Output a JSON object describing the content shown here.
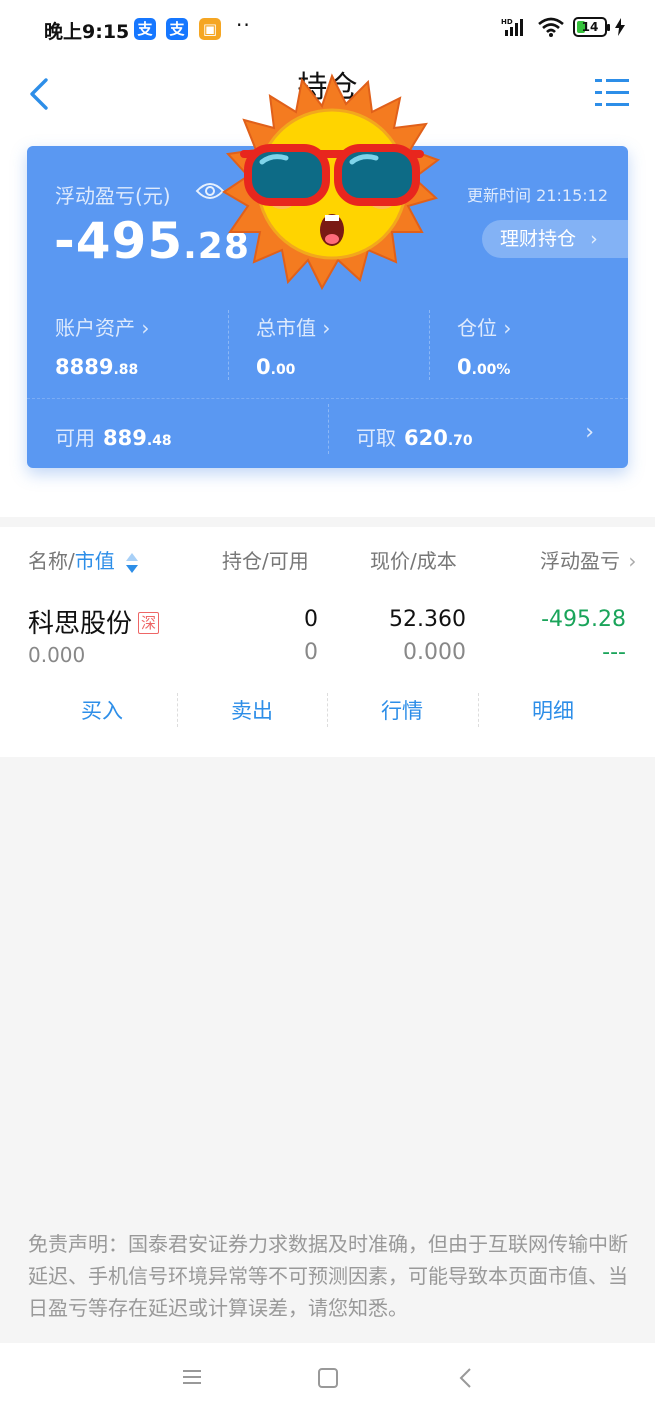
{
  "status_bar": {
    "time": "晚上9:15",
    "apps": [
      "支",
      "支",
      "▣"
    ],
    "dots": "··",
    "battery": "14"
  },
  "header": {
    "title": "持仓"
  },
  "summary": {
    "pl_label": "浮动盈亏(元)",
    "pl_int": "-495",
    "pl_dec": ".28",
    "update_label": "更新时间 21:15:12",
    "wealth_button": "理财持仓",
    "assets_label": "账户资产",
    "assets_int": "8889",
    "assets_dec": ".88",
    "market_label": "总市值",
    "market_int": "0",
    "market_dec": ".00",
    "position_label": "仓位",
    "position_int": "0",
    "position_dec": ".00%",
    "available_label": "可用",
    "available_int": "889",
    "available_dec": ".48",
    "withdraw_label": "可取",
    "withdraw_int": "620",
    "withdraw_dec": ".70"
  },
  "table": {
    "col_name": "名称/",
    "col_name_sort": "市值",
    "col_qty": "持仓/可用",
    "col_price": "现价/成本",
    "col_pl": "浮动盈亏",
    "rows": [
      {
        "name": "科思股份",
        "market": "深",
        "market_value": "0.000",
        "qty": "0",
        "available": "0",
        "price": "52.360",
        "cost": "0.000",
        "pl": "-495.28",
        "pl_pct": "---"
      }
    ],
    "actions": [
      "买入",
      "卖出",
      "行情",
      "明细"
    ]
  },
  "disclaimer": "免责声明：国泰君安证券力求数据及时准确，但由于互联网传输中断延迟、手机信号环境异常等不可预测因素，可能导致本页面市值、当日盈亏等存在延迟或计算误差，请您知悉。",
  "colors": {
    "card": "#5a98f2",
    "accent": "#2d8ee8",
    "loss_green": "#1aa45a"
  }
}
